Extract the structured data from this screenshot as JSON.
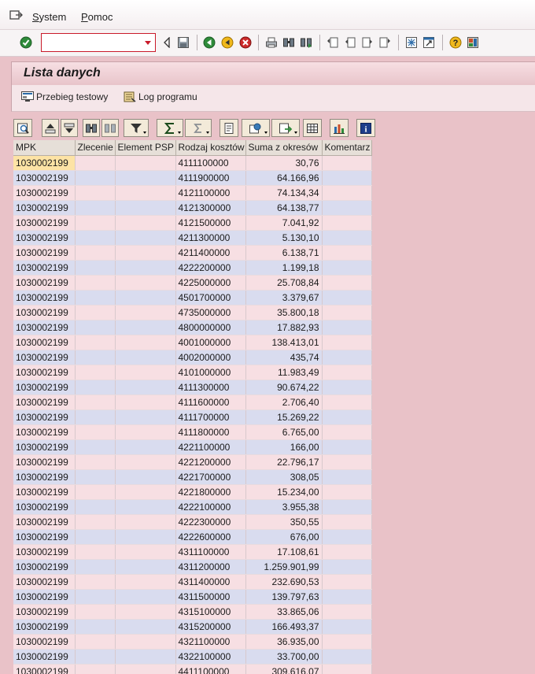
{
  "menu": {
    "items": [
      {
        "label": "System",
        "accel": "S",
        "rest": "ystem"
      },
      {
        "label": "Pomoc",
        "accel": "P",
        "rest": "omoc"
      }
    ]
  },
  "command_field": {
    "value": ""
  },
  "title": "Lista danych",
  "app_toolbar": {
    "test_run": "Przebieg testowy",
    "program_log": "Log programu"
  },
  "grid": {
    "columns": [
      "MPK",
      "Zlecenie",
      "Element PSP",
      "Rodzaj kosztów",
      "Suma z okresów",
      "Komentarz"
    ],
    "rows": [
      [
        "1030002199",
        "",
        "",
        "4111100000",
        "30,76",
        ""
      ],
      [
        "1030002199",
        "",
        "",
        "4111900000",
        "64.166,96",
        ""
      ],
      [
        "1030002199",
        "",
        "",
        "4121100000",
        "74.134,34",
        ""
      ],
      [
        "1030002199",
        "",
        "",
        "4121300000",
        "64.138,77",
        ""
      ],
      [
        "1030002199",
        "",
        "",
        "4121500000",
        "7.041,92",
        ""
      ],
      [
        "1030002199",
        "",
        "",
        "4211300000",
        "5.130,10",
        ""
      ],
      [
        "1030002199",
        "",
        "",
        "4211400000",
        "6.138,71",
        ""
      ],
      [
        "1030002199",
        "",
        "",
        "4222200000",
        "1.199,18",
        ""
      ],
      [
        "1030002199",
        "",
        "",
        "4225000000",
        "25.708,84",
        ""
      ],
      [
        "1030002199",
        "",
        "",
        "4501700000",
        "3.379,67",
        ""
      ],
      [
        "1030002199",
        "",
        "",
        "4735000000",
        "35.800,18",
        ""
      ],
      [
        "1030002199",
        "",
        "",
        "4800000000",
        "17.882,93",
        ""
      ],
      [
        "1030002199",
        "",
        "",
        "4001000000",
        "138.413,01",
        ""
      ],
      [
        "1030002199",
        "",
        "",
        "4002000000",
        "435,74",
        ""
      ],
      [
        "1030002199",
        "",
        "",
        "4101000000",
        "11.983,49",
        ""
      ],
      [
        "1030002199",
        "",
        "",
        "4111300000",
        "90.674,22",
        ""
      ],
      [
        "1030002199",
        "",
        "",
        "4111600000",
        "2.706,40",
        ""
      ],
      [
        "1030002199",
        "",
        "",
        "4111700000",
        "15.269,22",
        ""
      ],
      [
        "1030002199",
        "",
        "",
        "4111800000",
        "6.765,00",
        ""
      ],
      [
        "1030002199",
        "",
        "",
        "4221100000",
        "166,00",
        ""
      ],
      [
        "1030002199",
        "",
        "",
        "4221200000",
        "22.796,17",
        ""
      ],
      [
        "1030002199",
        "",
        "",
        "4221700000",
        "308,05",
        ""
      ],
      [
        "1030002199",
        "",
        "",
        "4221800000",
        "15.234,00",
        ""
      ],
      [
        "1030002199",
        "",
        "",
        "4222100000",
        "3.955,38",
        ""
      ],
      [
        "1030002199",
        "",
        "",
        "4222300000",
        "350,55",
        ""
      ],
      [
        "1030002199",
        "",
        "",
        "4222600000",
        "676,00",
        ""
      ],
      [
        "1030002199",
        "",
        "",
        "4311100000",
        "17.108,61",
        ""
      ],
      [
        "1030002199",
        "",
        "",
        "4311200000",
        "1.259.901,99",
        ""
      ],
      [
        "1030002199",
        "",
        "",
        "4311400000",
        "232.690,53",
        ""
      ],
      [
        "1030002199",
        "",
        "",
        "4311500000",
        "139.797,63",
        ""
      ],
      [
        "1030002199",
        "",
        "",
        "4315100000",
        "33.865,06",
        ""
      ],
      [
        "1030002199",
        "",
        "",
        "4315200000",
        "166.493,37",
        ""
      ],
      [
        "1030002199",
        "",
        "",
        "4321100000",
        "36.935,00",
        ""
      ],
      [
        "1030002199",
        "",
        "",
        "4322100000",
        "33.700,00",
        ""
      ],
      [
        "1030002199",
        "",
        "",
        "4411100000",
        "309.616,07",
        ""
      ]
    ]
  },
  "colors": {
    "background": "#e9c2c8",
    "row_odd": "#f7dfe3",
    "row_even": "#d9dcef",
    "selected_cell": "#fde3a5",
    "command_field_border": "#c91a2a"
  }
}
